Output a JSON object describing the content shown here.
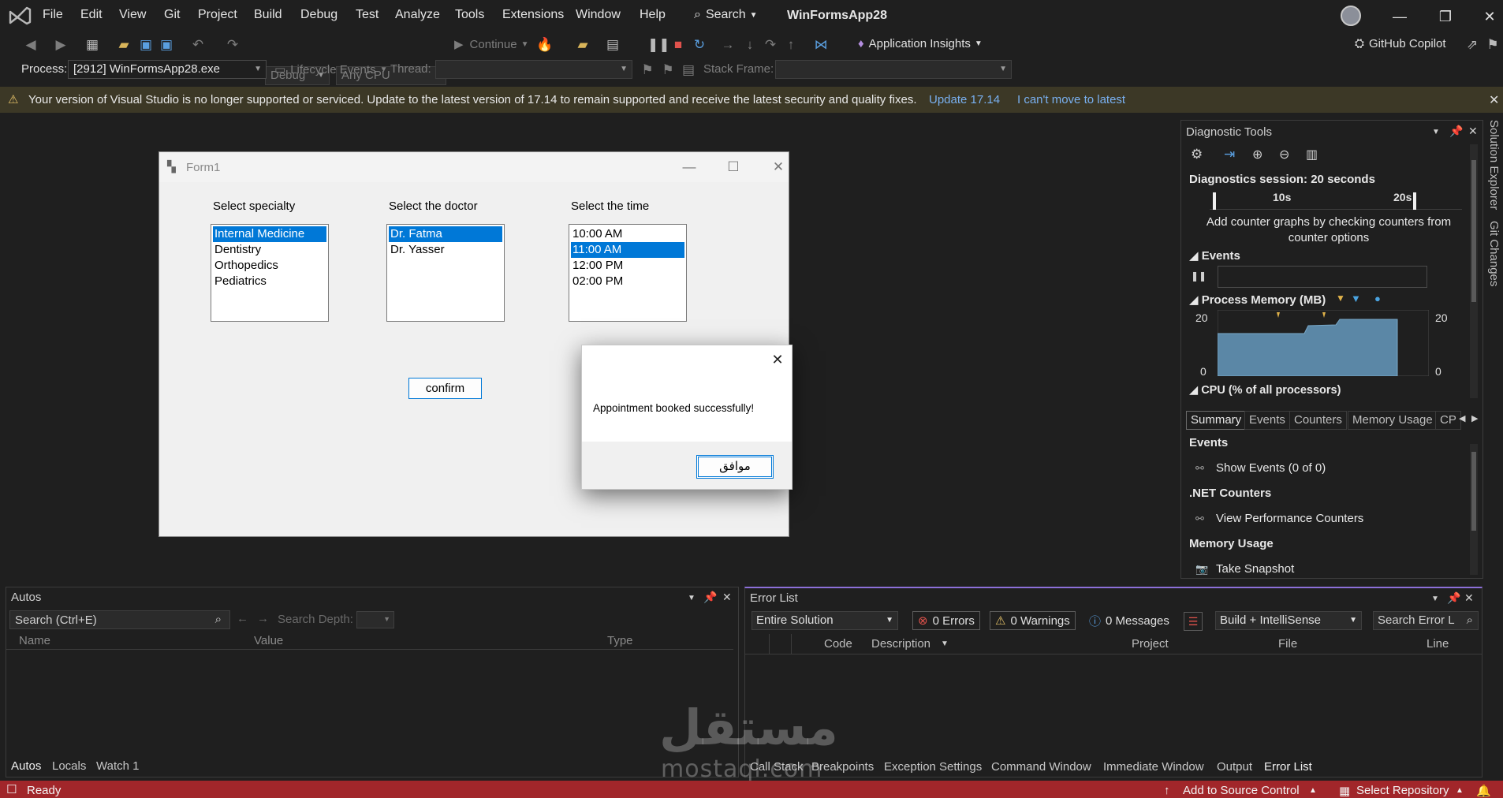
{
  "menubar": {
    "items": [
      "File",
      "Edit",
      "View",
      "Git",
      "Project",
      "Build",
      "Debug",
      "Test",
      "Analyze",
      "Tools",
      "Extensions",
      "Window",
      "Help"
    ],
    "search": "Search",
    "solution": "WinFormsApp28"
  },
  "toolbar": {
    "config": "Debug",
    "platform": "Any CPU",
    "continue": "Continue",
    "app_insights": "Application Insights",
    "copilot": "GitHub Copilot",
    "process_label": "Process:",
    "process_value": "[2912] WinFormsApp28.exe",
    "lifecycle": "Lifecycle Events",
    "thread_label": "Thread:",
    "stack_label": "Stack Frame:"
  },
  "notification": {
    "text": "Your version of Visual Studio is no longer supported or serviced. Update to the latest version of 17.14 to remain supported and receive the latest security and quality fixes.",
    "update_link": "Update 17.14",
    "cant_link": "I can't move to latest"
  },
  "form1": {
    "title": "Form1",
    "specialty_label": "Select specialty",
    "doctor_label": "Select the doctor",
    "time_label": "Select the time",
    "specialties": [
      "Internal Medicine",
      "Dentistry",
      "Orthopedics",
      "Pediatrics"
    ],
    "doctors": [
      "Dr. Fatma",
      "Dr. Yasser"
    ],
    "times": [
      "10:00 AM",
      "11:00 AM",
      "12:00 PM",
      "02:00 PM"
    ],
    "confirm": "confirm"
  },
  "msgbox": {
    "message": "Appointment booked successfully!",
    "ok": "موافق"
  },
  "diagnostics": {
    "title": "Diagnostic Tools",
    "session": "Diagnostics session: 20 seconds",
    "tick_10": "10s",
    "tick_20": "20s",
    "hint": "Add counter graphs by checking counters from counter options",
    "events_hdr": "Events",
    "memory_hdr": "Process Memory (MB)",
    "mem_max": "20",
    "mem_min": "0",
    "cpu_hdr": "CPU (% of all processors)",
    "tabs": [
      "Summary",
      "Events",
      "Counters",
      "Memory Usage",
      "CP"
    ],
    "summary_events": "Events",
    "show_events": "Show Events (0 of 0)",
    "net_counters": ".NET Counters",
    "view_counters": "View Performance Counters",
    "memory_usage": "Memory Usage",
    "take_snapshot": "Take Snapshot"
  },
  "side_tabs": [
    "Solution Explorer",
    "Git Changes"
  ],
  "autos": {
    "title": "Autos",
    "search_placeholder": "Search (Ctrl+E)",
    "search_depth": "Search Depth:",
    "columns": [
      "Name",
      "Value",
      "Type"
    ],
    "tabs": [
      "Autos",
      "Locals",
      "Watch 1"
    ]
  },
  "errorlist": {
    "title": "Error List",
    "scope": "Entire Solution",
    "errors": "0 Errors",
    "warnings": "0 Warnings",
    "messages": "0 Messages",
    "build": "Build + IntelliSense",
    "search_placeholder": "Search Error L",
    "columns": [
      "Code",
      "Description",
      "Project",
      "File",
      "Line"
    ],
    "tabs": [
      "Call Stack",
      "Breakpoints",
      "Exception Settings",
      "Command Window",
      "Immediate Window",
      "Output",
      "Error List"
    ]
  },
  "status": {
    "ready": "Ready",
    "source_control": "Add to Source Control",
    "repository": "Select Repository"
  },
  "watermark": {
    "arabic": "مستقل",
    "latin": "mostaql.com"
  },
  "colors": {
    "selection": "#0078d7",
    "status_bar": "#a1262a",
    "info_bar": "#3c3826",
    "link": "#79b0f0",
    "memory_fill": "#5b87a6"
  }
}
